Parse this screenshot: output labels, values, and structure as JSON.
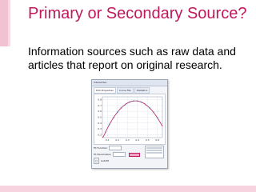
{
  "slide": {
    "title": "Primary or Secondary Source?",
    "body": "Information sources such as raw data and articles that report on original research."
  },
  "screenshot": {
    "window_title": "Interactive",
    "tabs": [
      {
        "label": "Plot Properties"
      },
      {
        "label": "Curve Fits"
      },
      {
        "label": "Statistics"
      }
    ],
    "controls": {
      "row1_label": "Fit Function",
      "row2_label": "Fit Parameters",
      "row3_label": "Autofit"
    }
  },
  "colors": {
    "title": "#c0185a",
    "curve": "#c0185a",
    "band": "#f3c2d2"
  },
  "chart_data": {
    "type": "scatter",
    "title": "",
    "xlabel": "",
    "ylabel": "",
    "x_ticks": [
      "0.1",
      "0.2",
      "0.3",
      "0.4",
      "0.5",
      "0.6"
    ],
    "y_ticks": [
      "0.2",
      "0.3",
      "0.4",
      "0.5",
      "0.6",
      "0.7",
      "0.8"
    ],
    "xlim": [
      0.05,
      0.65
    ],
    "ylim": [
      0.15,
      0.85
    ],
    "fit_curve": {
      "vertex_x": 0.38,
      "vertex_y": 0.78,
      "a": -6.0
    },
    "points_x": [
      0.08,
      0.12,
      0.16,
      0.2,
      0.24,
      0.28,
      0.32,
      0.36,
      0.4,
      0.44,
      0.48,
      0.52,
      0.56,
      0.6
    ],
    "grid": true
  }
}
